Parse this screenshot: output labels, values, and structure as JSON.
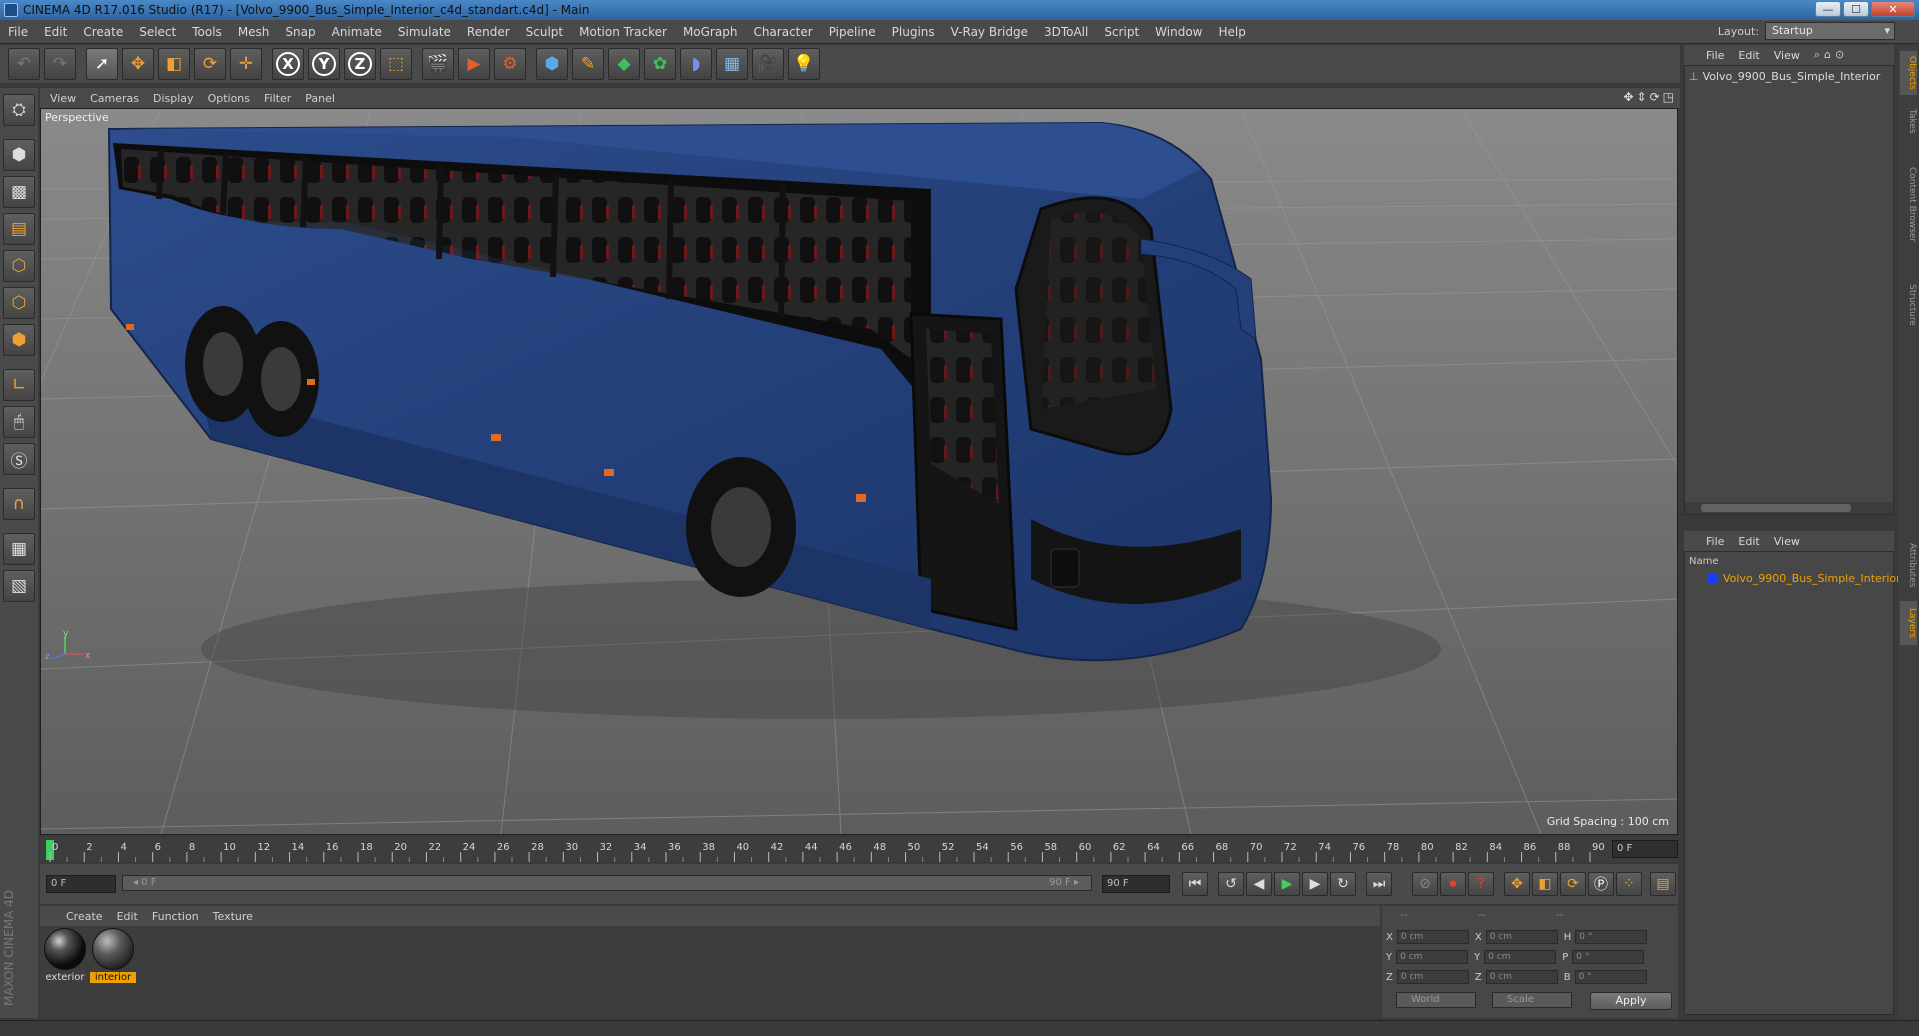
{
  "window": {
    "title": "CINEMA 4D R17.016 Studio (R17) - [Volvo_9900_Bus_Simple_Interior_c4d_standart.c4d] - Main",
    "controls": {
      "minimize": "—",
      "maximize": "☐",
      "close": "✕"
    }
  },
  "menu": [
    "File",
    "Edit",
    "Create",
    "Select",
    "Tools",
    "Mesh",
    "Snap",
    "Animate",
    "Simulate",
    "Render",
    "Sculpt",
    "Motion Tracker",
    "MoGraph",
    "Character",
    "Pipeline",
    "Plugins",
    "V-Ray Bridge",
    "3DToAll",
    "Script",
    "Window",
    "Help"
  ],
  "layout": {
    "label": "Layout:",
    "value": "Startup"
  },
  "toolbar_icons": [
    "undo-icon",
    "redo-icon",
    "live-selection-icon",
    "move-icon",
    "scale-icon",
    "rotate-icon",
    "transform-icon",
    "x-axis-icon",
    "y-axis-icon",
    "z-axis-icon",
    "coordinate-system-icon",
    "render-view-icon",
    "render-picture-viewer-icon",
    "edit-render-settings-icon",
    "cube-icon",
    "pen-spline-icon",
    "subdivision-icon",
    "cloner-icon",
    "deformer-icon",
    "floor-icon",
    "camera-icon",
    "light-icon"
  ],
  "viewport": {
    "menu": [
      "View",
      "Cameras",
      "Display",
      "Options",
      "Filter",
      "Panel"
    ],
    "name": "Perspective",
    "grid_spacing": "Grid Spacing : 100 cm",
    "axis_labels": {
      "y": "y",
      "z": "z",
      "x": "x"
    }
  },
  "timeline": {
    "ticks": [
      "0",
      "2",
      "4",
      "6",
      "8",
      "10",
      "12",
      "14",
      "16",
      "18",
      "20",
      "22",
      "24",
      "26",
      "28",
      "30",
      "32",
      "34",
      "36",
      "38",
      "40",
      "42",
      "44",
      "46",
      "48",
      "50",
      "52",
      "54",
      "56",
      "58",
      "60",
      "62",
      "64",
      "66",
      "68",
      "70",
      "72",
      "74",
      "76",
      "78",
      "80",
      "82",
      "84",
      "86",
      "88",
      "90"
    ],
    "current_frame": "0 F",
    "start_field": "0 F",
    "slider_start": "◂ 0 F",
    "slider_end": "90 F ▸",
    "end_field": "90 F"
  },
  "materials": {
    "menu": [
      "Create",
      "Edit",
      "Function",
      "Texture"
    ],
    "items": [
      {
        "label": "exterior",
        "selected": false
      },
      {
        "label": "interior",
        "selected": true
      }
    ]
  },
  "coordinates": {
    "header": [
      "--",
      "--",
      "--"
    ],
    "rows": [
      {
        "a": "X",
        "av": "0 cm",
        "b": "X",
        "bv": "0 cm",
        "c": "H",
        "cv": "0 °"
      },
      {
        "a": "Y",
        "av": "0 cm",
        "b": "Y",
        "bv": "0 cm",
        "c": "P",
        "cv": "0 °"
      },
      {
        "a": "Z",
        "av": "0 cm",
        "b": "Z",
        "bv": "0 cm",
        "c": "B",
        "cv": "0 °"
      }
    ],
    "mode": "World",
    "transform": "Scale",
    "apply": "Apply"
  },
  "objects": {
    "menu": [
      "File",
      "Edit",
      "View"
    ],
    "item": "Volvo_9900_Bus_Simple_Interior"
  },
  "layers": {
    "menu": [
      "File",
      "Edit",
      "View"
    ],
    "column": "Name",
    "item": "Volvo_9900_Bus_Simple_Interior",
    "item_color": "#1a3cff"
  },
  "side_tabs": [
    "Objects",
    "Takes",
    "Content Browser",
    "Structure",
    "Attributes",
    "Layers"
  ],
  "brand": "MAXON CINEMA 4D",
  "colors": {
    "accent": "#f0a000",
    "bus_body": "#233f7a"
  }
}
